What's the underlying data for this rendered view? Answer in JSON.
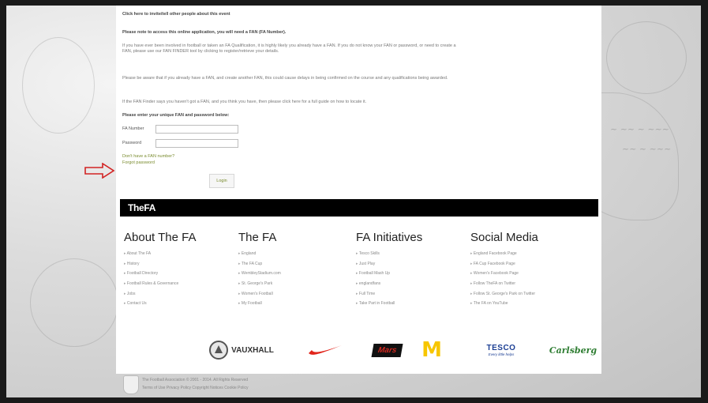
{
  "content": {
    "top_link": "Click here to invite/tell other people about this event",
    "fan_note": "Please note to access this online application, you will need a FAN (FA Number).",
    "para1": "If you have ever been involved in football or taken an FA Qualification, it is highly likely you already have a FAN. If you do not know your FAN or password, or need to create a FAN, please use our FAN FINDER tool by clicking to register/retrieve your details.",
    "para2": "Please be aware that if you already have a FAN, and create another FAN, this could cause delays in being confirmed on the course and any qualifications being awarded.",
    "para3": "If the FAN Finder says you haven't got a FAN, and you think you have, then please click here for a full guide on how to locate it.",
    "enter_prompt": "Please enter your unique FAN and password below:",
    "fan_label": "FA Number",
    "password_label": "Password",
    "no_fan_link": "Don't have a FAN number?",
    "forgot_link": "Forgot password",
    "login_button": "Login"
  },
  "brand": {
    "bar_title": "TheFA"
  },
  "footer": {
    "columns": [
      {
        "title": "About The FA",
        "items": [
          "About The FA",
          "History",
          "Football Directory",
          "Football Rules & Governance",
          "Jobs",
          "Contact Us"
        ]
      },
      {
        "title": "The FA",
        "items": [
          "England",
          "The FA Cup",
          "WembleyStadium.com",
          "St. George's Park",
          "Women's Football",
          "My Football"
        ]
      },
      {
        "title": "FA Initiatives",
        "items": [
          "Tesco Skills",
          "Just Play",
          "Football Mash Up",
          "englandfans",
          "Full Time",
          "Take Part in Football"
        ]
      },
      {
        "title": "Social Media",
        "items": [
          "England Facebook Page",
          "FA Cup Facebook Page",
          "Women's Facebook Page",
          "Follow TheFA on Twitter",
          "Follow St. George's Park on Twitter",
          "The FA on YouTube"
        ]
      }
    ]
  },
  "sponsors": {
    "vauxhall": "VAUXHALL",
    "mars": "Mars",
    "mcdonalds": "M",
    "tesco": "TESCO",
    "tesco_tag": "Every little helps",
    "carlsberg": "Carlsberg"
  },
  "legal": {
    "copyright": "The Football Association © 2001 - 2014. All Rights Reserved",
    "links": "Terms of Use   Privacy Policy   Copyright Notices   Cookie Policy"
  },
  "colors": {
    "accent_green": "#7a8c2f",
    "arrow_red": "#d22222",
    "nike_red": "#e1251b",
    "mcd_yellow": "#f7c600",
    "carlsberg_green": "#2e7d32",
    "tesco_blue": "#1c3f94"
  }
}
